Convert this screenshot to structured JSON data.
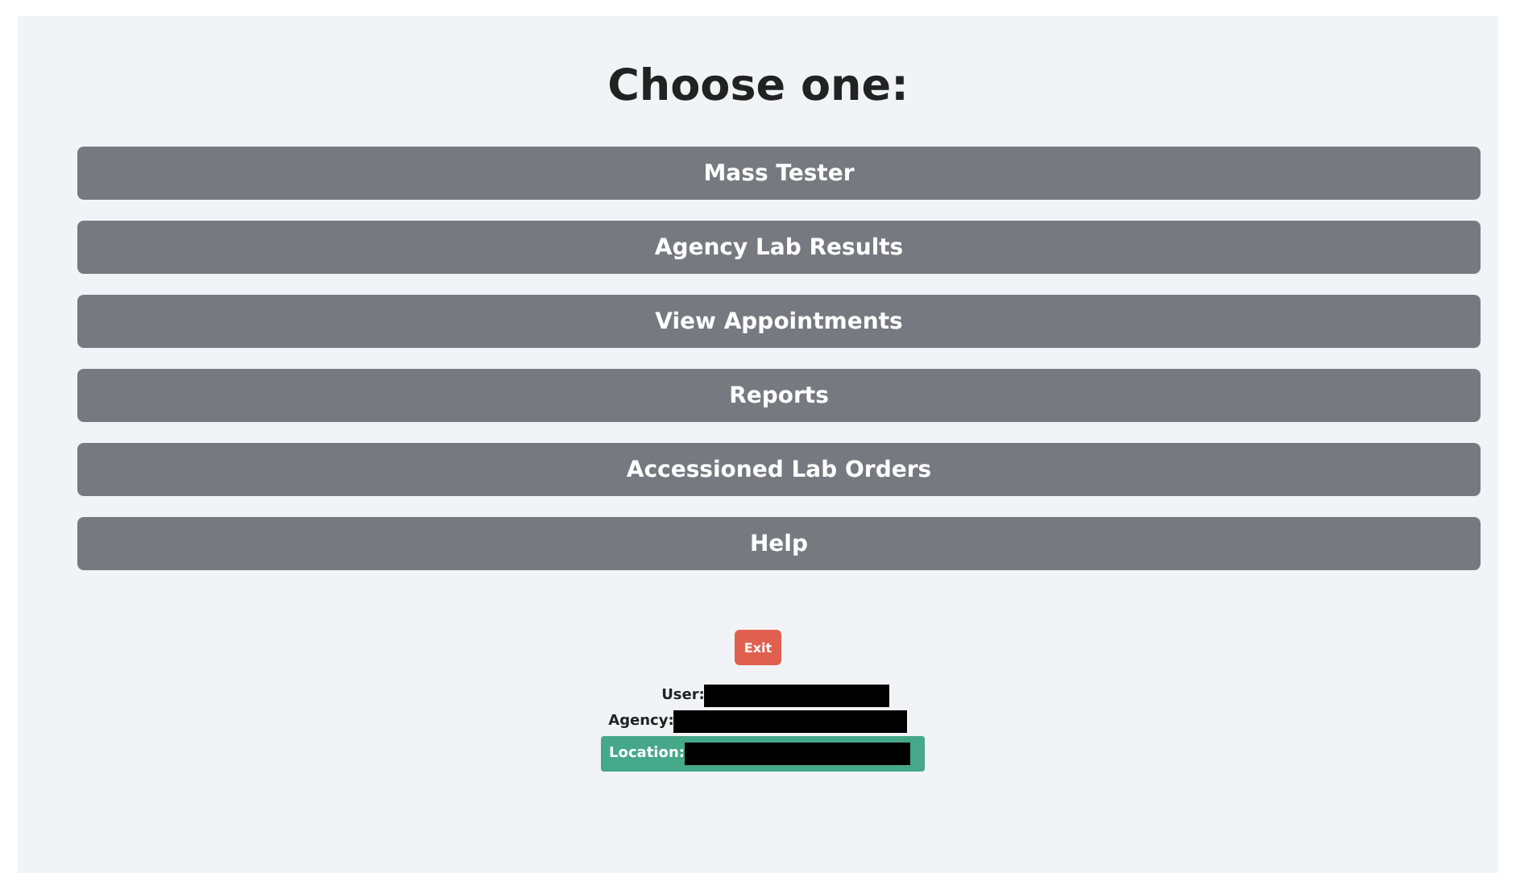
{
  "title": "Choose one:",
  "options": [
    {
      "label": "Mass Tester"
    },
    {
      "label": "Agency Lab Results"
    },
    {
      "label": "View Appointments"
    },
    {
      "label": "Reports"
    },
    {
      "label": "Accessioned Lab Orders"
    },
    {
      "label": "Help"
    }
  ],
  "exit_button": {
    "label": "Exit"
  },
  "info": [
    {
      "label": "User:",
      "highlighted": false
    },
    {
      "label": "Agency:",
      "highlighted": false
    },
    {
      "label": "Location:",
      "highlighted": true
    }
  ]
}
